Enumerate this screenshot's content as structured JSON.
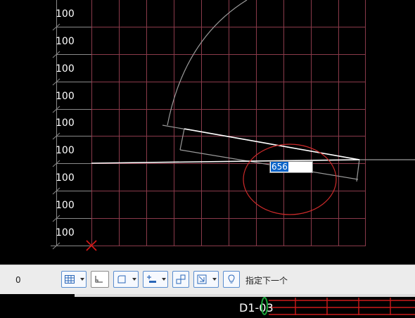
{
  "row_labels": [
    "100",
    "100",
    "100",
    "100",
    "100",
    "100",
    "100",
    "100",
    "100"
  ],
  "dynamic_input": {
    "value": "656"
  },
  "status": {
    "coordinate": "0",
    "prompt": "指定下一个"
  },
  "toolbar": [
    {
      "name": "grid-snap-button",
      "icon": "grid-icon",
      "dropdown": true
    },
    {
      "name": "ortho-button",
      "icon": "ortho-icon",
      "dropdown": false
    },
    {
      "name": "polar-button",
      "icon": "polar-icon",
      "dropdown": true
    },
    {
      "name": "object-snap-button",
      "icon": "object-snap-icon",
      "dropdown": true
    },
    {
      "name": "object-track-button",
      "icon": "track-icon",
      "dropdown": false
    },
    {
      "name": "dynamic-ucs-button",
      "icon": "dynamic-ucs-icon",
      "dropdown": true
    },
    {
      "name": "hint-button",
      "icon": "lightbulb-icon",
      "dropdown": false
    }
  ],
  "bottom_label": "D1-03",
  "colors": {
    "grid": "#8a3a4a",
    "axis": "#888888",
    "rubberband": "#ffffff",
    "circle": "#cc2a2a",
    "origin_mark": "#dd1a1a",
    "input_highlight": "#0a64c8",
    "status_bg": "#ececec",
    "toolbar_border": "#5a8ed0"
  }
}
